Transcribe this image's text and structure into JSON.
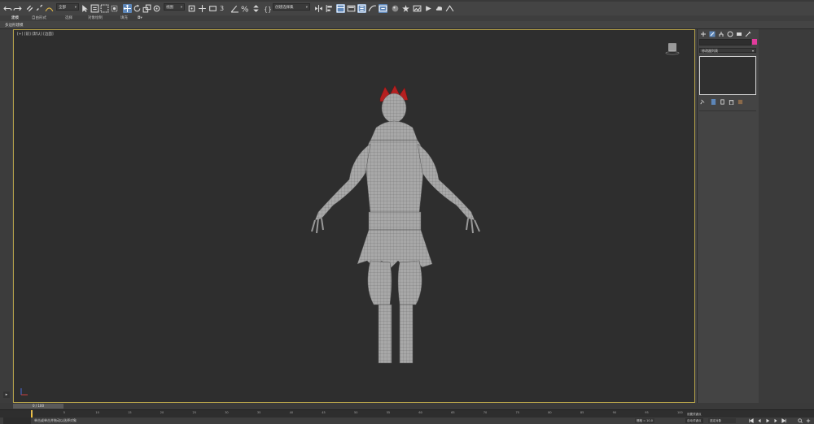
{
  "toolbar": {
    "selection_filter": "全部",
    "reference_coord": "视图",
    "named_selection": "创建选择集",
    "snap_label": "3"
  },
  "ribbon": {
    "tabs": [
      "建模",
      "自由形式",
      "选择",
      "对象绘制",
      "填充"
    ],
    "active_tab": "建模",
    "panel_label": "多边形建模"
  },
  "viewport": {
    "label": "[+] [前] [默认] [边面]",
    "viewcube_face": "前"
  },
  "command_panel": {
    "modifier_list": "修改器列表"
  },
  "timeline": {
    "frame_display": "0 / 100",
    "ticks": [
      "0",
      "5",
      "10",
      "15",
      "20",
      "25",
      "30",
      "35",
      "40",
      "45",
      "50",
      "55",
      "60",
      "65",
      "70",
      "75",
      "80",
      "85",
      "90",
      "95",
      "100"
    ]
  },
  "statusbar": {
    "prompt": "单击或单击并拖动以选择对象",
    "grid": "栅格 = 10.0",
    "autokey": "自动关键点",
    "selected": "选定对象",
    "set_key": "设置关键点"
  },
  "colors": {
    "accent": "#5d86b8",
    "viewport_border": "#b6a24a",
    "object_color": "#e23b9c",
    "time_marker": "#f0c040"
  }
}
